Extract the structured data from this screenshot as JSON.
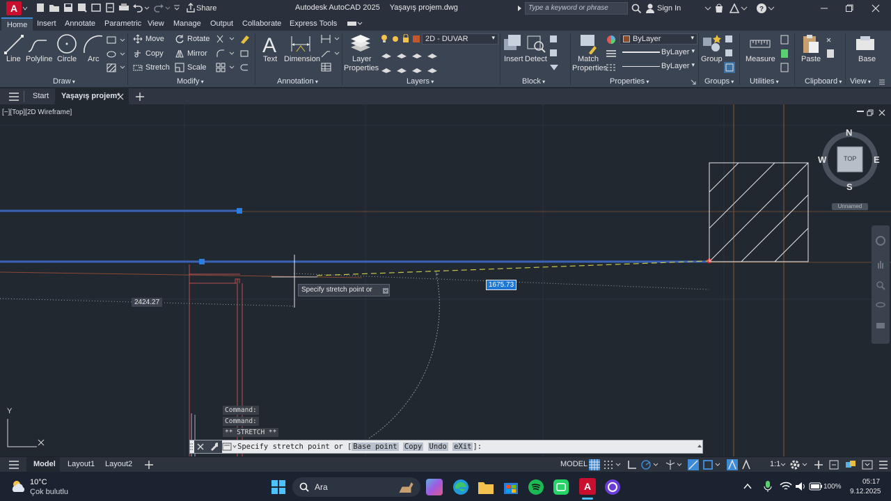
{
  "app": {
    "title": "Autodesk AutoCAD 2025",
    "filename": "Yaşayış projem.dwg",
    "share_label": "Share",
    "search_placeholder": "Type a keyword or phrase",
    "sign_in": "Sign In",
    "logo_letter": "A"
  },
  "ribbon_tabs": [
    "Home",
    "Insert",
    "Annotate",
    "Parametric",
    "View",
    "Manage",
    "Output",
    "Collaborate",
    "Express Tools"
  ],
  "draw": {
    "line": "Line",
    "polyline": "Polyline",
    "circle": "Circle",
    "arc": "Arc",
    "panel": "Draw"
  },
  "modify": {
    "move": "Move",
    "copy": "Copy",
    "stretch": "Stretch",
    "rotate": "Rotate",
    "mirror": "Mirror",
    "scale": "Scale",
    "panel": "Modify"
  },
  "annotation": {
    "text": "Text",
    "dimension": "Dimension",
    "panel": "Annotation"
  },
  "layers": {
    "layer_properties_1": "Layer",
    "layer_properties_2": "Properties",
    "current_layer": "2D - DUVAR",
    "panel": "Layers"
  },
  "block": {
    "insert": "Insert",
    "detect": "Detect",
    "panel": "Block"
  },
  "properties": {
    "match_1": "Match",
    "match_2": "Properties",
    "color": "ByLayer",
    "linetype": "ByLayer",
    "lineweight": "ByLayer",
    "panel": "Properties"
  },
  "groups": {
    "group": "Group",
    "panel": "Groups"
  },
  "utilities": {
    "measure": "Measure",
    "panel": "Utilities"
  },
  "clipboard": {
    "paste": "Paste",
    "panel": "Clipboard"
  },
  "viewp": {
    "base": "Base",
    "panel": "View"
  },
  "file_tabs": {
    "start": "Start",
    "current": "Yaşayış projem*"
  },
  "viewport": {
    "label": "[−][Top][2D Wireframe]",
    "viewcube_top": "TOP",
    "compass": {
      "n": "N",
      "s": "S",
      "e": "E",
      "w": "W"
    },
    "ucs_name": "Unnamed",
    "tooltip": "Specify stretch point or",
    "dim_left": "2424.27",
    "dim_input": "1675.73",
    "ucs_y": "Y"
  },
  "command": {
    "history": [
      "Command:",
      "Command:",
      "** STRETCH **"
    ],
    "prompt_text": "Specify stretch point or [",
    "options": [
      "Base point",
      "Copy",
      "Undo",
      "eXit"
    ],
    "prompt_end": "]:"
  },
  "status": {
    "model_tab": "Model",
    "layout1": "Layout1",
    "layout2": "Layout2",
    "model_btn": "MODEL",
    "scale": "1:1"
  },
  "taskbar": {
    "weather_temp": "10°C",
    "weather_desc": "Çok bulutlu",
    "search": "Ara",
    "battery": "100%",
    "time": "05:17",
    "date": "9.12.2025"
  },
  "colors": {
    "accent": "#3d8bd6",
    "autocad_red": "#c8102e",
    "canvas": "#212830",
    "selected_line": "#3a64b8",
    "grip": "#2a7de1"
  }
}
